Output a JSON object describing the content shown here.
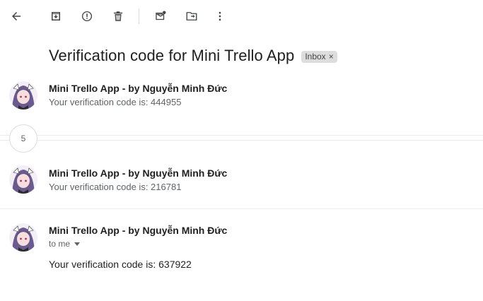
{
  "toolbar": {
    "items": [
      "back-arrow-icon",
      "archive-icon",
      "report-spam-icon",
      "delete-icon",
      "mark-unread-icon",
      "move-to-icon",
      "more-vert-icon"
    ]
  },
  "thread": {
    "subject": "Verification code for Mini Trello App",
    "label": "Inbox",
    "label_close": "×"
  },
  "messages": [
    {
      "sender": "Mini Trello App - by Nguyễn Minh Đức",
      "snippet": "Your verification code is: 444955"
    },
    {
      "sender": "Mini Trello App - by Nguyễn Minh Đức",
      "snippet": "Your verification code is: 216781"
    },
    {
      "sender": "Mini Trello App - by Nguyễn Minh Đức",
      "recipient": "to me",
      "body": "Your verification code is: 637922"
    }
  ],
  "collapsed": {
    "count": "5"
  },
  "colors": {
    "icon": "#444746",
    "divider": "#e8eaed",
    "chip_bg": "#dddddd",
    "avatar_hair": "#6b5a8e"
  }
}
